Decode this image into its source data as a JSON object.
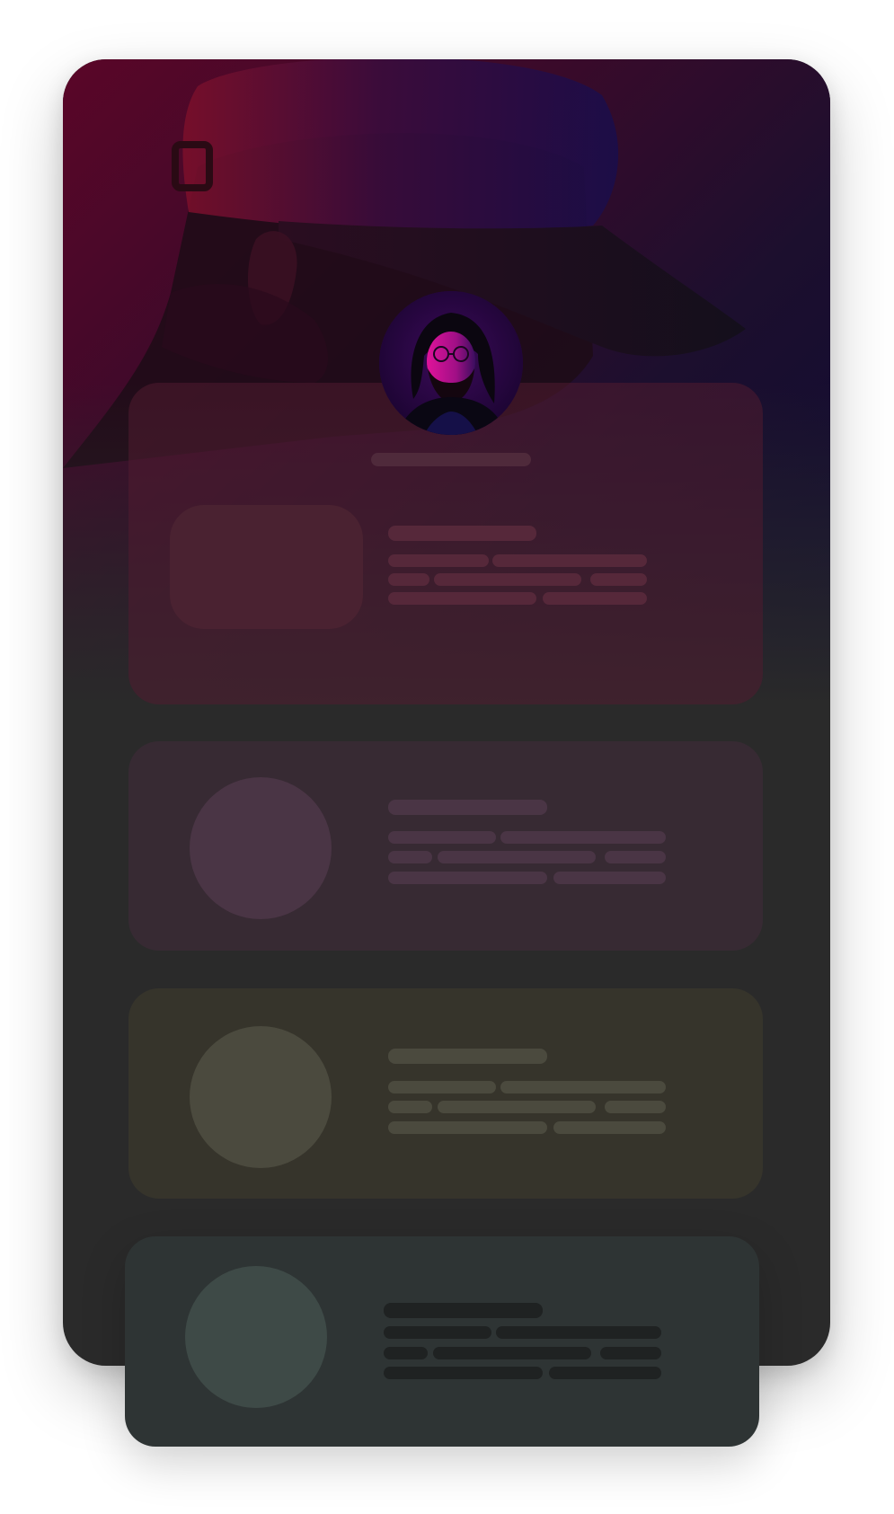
{
  "colors": {
    "hero_top_left": "#5a0628",
    "hero_top_right": "#0e0a33",
    "phone_background": "#2a2a2a",
    "card_profile": "#4a1f31",
    "card_purple": "#372a33",
    "card_olive": "#36342b",
    "card_teal": "#2e3434"
  },
  "icons": {
    "hero": "cap-wearing-person-photo",
    "avatar": "bearded-person-portrait"
  },
  "cards": [
    {
      "kind": "profile-card",
      "media": "rounded-square-placeholder"
    },
    {
      "kind": "purple-card",
      "media": "circle-placeholder"
    },
    {
      "kind": "olive-card",
      "media": "circle-placeholder"
    },
    {
      "kind": "teal-card",
      "media": "circle-placeholder"
    }
  ]
}
